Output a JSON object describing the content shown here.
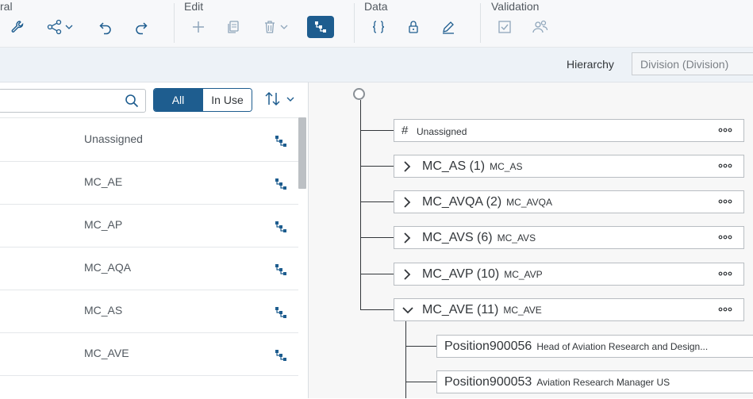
{
  "toolbar": {
    "groups": {
      "general": "ral",
      "edit": "Edit",
      "data": "Data",
      "validation": "Validation"
    },
    "icons": {
      "general": [
        "wrench-icon",
        "share-icon",
        "undo-icon",
        "redo-icon"
      ],
      "edit": [
        "add-icon",
        "copy-icon",
        "delete-icon",
        "hierarchy-icon"
      ],
      "data": [
        "braces-icon",
        "lock-icon",
        "edit-pen-icon"
      ],
      "validation": [
        "checkbox-icon",
        "users-icon"
      ]
    },
    "active_color": "#1e5d8f"
  },
  "hierarchy": {
    "label": "Hierarchy",
    "selected": "Division (Division)"
  },
  "left_panel": {
    "search": {
      "value": "",
      "placeholder": ""
    },
    "filter": {
      "all": "All",
      "in_use": "In Use",
      "selected": "All"
    },
    "items": [
      "Unassigned",
      "MC_AE",
      "MC_AP",
      "MC_AQA",
      "MC_AS",
      "MC_AVE"
    ]
  },
  "tree": {
    "nodes": [
      {
        "title": "Unassigned",
        "code": "",
        "type": "leaf"
      },
      {
        "title": "MC_AS (1)",
        "code": "MC_AS",
        "type": "collapsed"
      },
      {
        "title": "MC_AVQA (2)",
        "code": "MC_AVQA",
        "type": "collapsed"
      },
      {
        "title": "MC_AVS (6)",
        "code": "MC_AVS",
        "type": "collapsed"
      },
      {
        "title": "MC_AVP (10)",
        "code": "MC_AVP",
        "type": "collapsed"
      },
      {
        "title": "MC_AVE (11)",
        "code": "MC_AVE",
        "type": "expanded"
      }
    ],
    "children": [
      {
        "title": "Position900056",
        "desc": "Head of Aviation Research and Design..."
      },
      {
        "title": "Position900053",
        "desc": "Aviation Research Manager US"
      }
    ]
  }
}
